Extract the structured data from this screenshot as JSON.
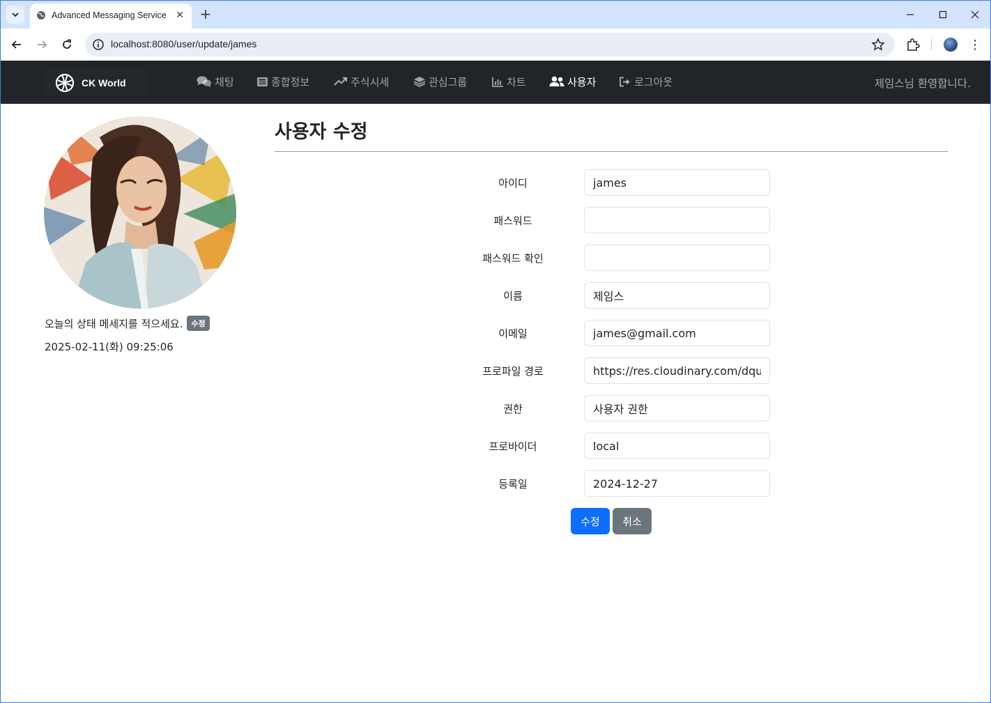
{
  "browser": {
    "tab_title": "Advanced Messaging Service",
    "tab_close_glyph": "✕",
    "new_tab_glyph": "+",
    "url": "localhost:8080/user/update/james",
    "kebab_glyph": "⋮"
  },
  "navbar": {
    "brand": "CK World",
    "items": [
      {
        "label": "채팅",
        "icon": "comments-icon"
      },
      {
        "label": "종합정보",
        "icon": "newspaper-icon"
      },
      {
        "label": "주식시세",
        "icon": "trend-up-icon"
      },
      {
        "label": "관심그룹",
        "icon": "layers-icon"
      },
      {
        "label": "차트",
        "icon": "bar-chart-icon"
      },
      {
        "label": "사용자",
        "icon": "users-icon",
        "active": true
      },
      {
        "label": "로그아웃",
        "icon": "sign-out-icon"
      }
    ],
    "welcome": "제임스님 환영합니다."
  },
  "profile": {
    "status_message": "오늘의 상태 메세지를 적으세요.",
    "status_edit_badge": "수정",
    "datetime": "2025-02-11(화) 09:25:06"
  },
  "form": {
    "title": "사용자 수정",
    "fields": [
      {
        "label": "아이디",
        "value": "james"
      },
      {
        "label": "패스워드",
        "value": ""
      },
      {
        "label": "패스워드 확인",
        "value": ""
      },
      {
        "label": "이름",
        "value": "제임스"
      },
      {
        "label": "이메일",
        "value": "james@gmail.com"
      },
      {
        "label": "프로파일 경로",
        "value": "https://res.cloudinary.com/dqul"
      },
      {
        "label": "권한",
        "value": "사용자 권한"
      },
      {
        "label": "프로바이더",
        "value": "local"
      },
      {
        "label": "등록일",
        "value": "2024-12-27"
      }
    ],
    "submit_label": "수정",
    "cancel_label": "취소"
  },
  "colors": {
    "navbar_bg": "#212529",
    "primary": "#0d6efd",
    "secondary": "#6c757d"
  }
}
